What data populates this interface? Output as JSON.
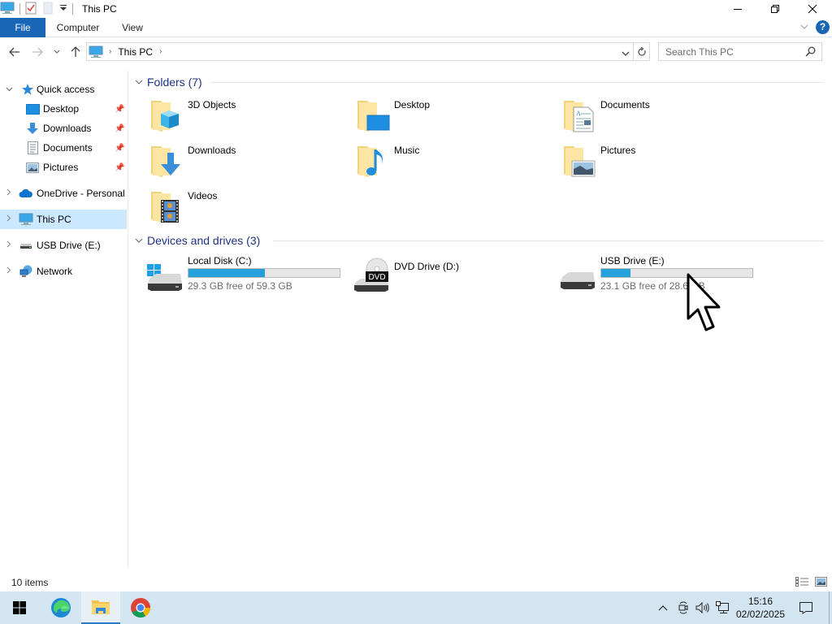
{
  "window": {
    "title": "This PC",
    "controls": {
      "minimize": "minimize",
      "restore": "restore",
      "close": "close"
    }
  },
  "ribbon": {
    "tabs": [
      {
        "label": "File",
        "active": true
      },
      {
        "label": "Computer"
      },
      {
        "label": "View"
      }
    ],
    "help_label": "?"
  },
  "address_bar": {
    "path": [
      "This PC"
    ],
    "search_placeholder": "Search This PC"
  },
  "sidebar": {
    "items": [
      {
        "label": "Quick access",
        "icon": "star-icon",
        "expanded": true
      },
      {
        "label": "Desktop",
        "icon": "desktop-icon",
        "pinned": true
      },
      {
        "label": "Downloads",
        "icon": "download-arrow-icon",
        "pinned": true
      },
      {
        "label": "Documents",
        "icon": "document-icon",
        "pinned": true
      },
      {
        "label": "Pictures",
        "icon": "picture-icon",
        "pinned": true
      },
      {
        "label": "OneDrive - Personal",
        "icon": "cloud-icon"
      },
      {
        "label": "This PC",
        "icon": "computer-icon",
        "selected": true
      },
      {
        "label": "USB Drive (E:)",
        "icon": "usb-drive-icon"
      },
      {
        "label": "Network",
        "icon": "network-icon"
      }
    ]
  },
  "content": {
    "folders_header": "Folders (7)",
    "folders": [
      {
        "name": "3D Objects"
      },
      {
        "name": "Desktop"
      },
      {
        "name": "Documents"
      },
      {
        "name": "Downloads"
      },
      {
        "name": "Music"
      },
      {
        "name": "Pictures"
      },
      {
        "name": "Videos"
      }
    ],
    "drives_header": "Devices and drives (3)",
    "drives": [
      {
        "name": "Local Disk (C:)",
        "free_text": "29.3 GB free of 59.3 GB",
        "used_fraction": 0.506
      },
      {
        "name": "DVD Drive (D:)",
        "badge": "DVD"
      },
      {
        "name": "USB Drive (E:)",
        "free_text": "23.1 GB free of 28.6 GB",
        "used_fraction": 0.192
      }
    ]
  },
  "status_bar": {
    "item_count": "10 items"
  },
  "taskbar": {
    "apps": [
      "Start",
      "Microsoft Edge",
      "File Explorer",
      "Google Chrome"
    ],
    "clock_time": "15:16",
    "clock_date": "02/02/2025"
  },
  "colors": {
    "accent": "#1966b7",
    "selection": "#cce8ff",
    "progress_fill": "#26a0da",
    "group_header": "#1e3287",
    "taskbar": "#d3e5f0"
  }
}
